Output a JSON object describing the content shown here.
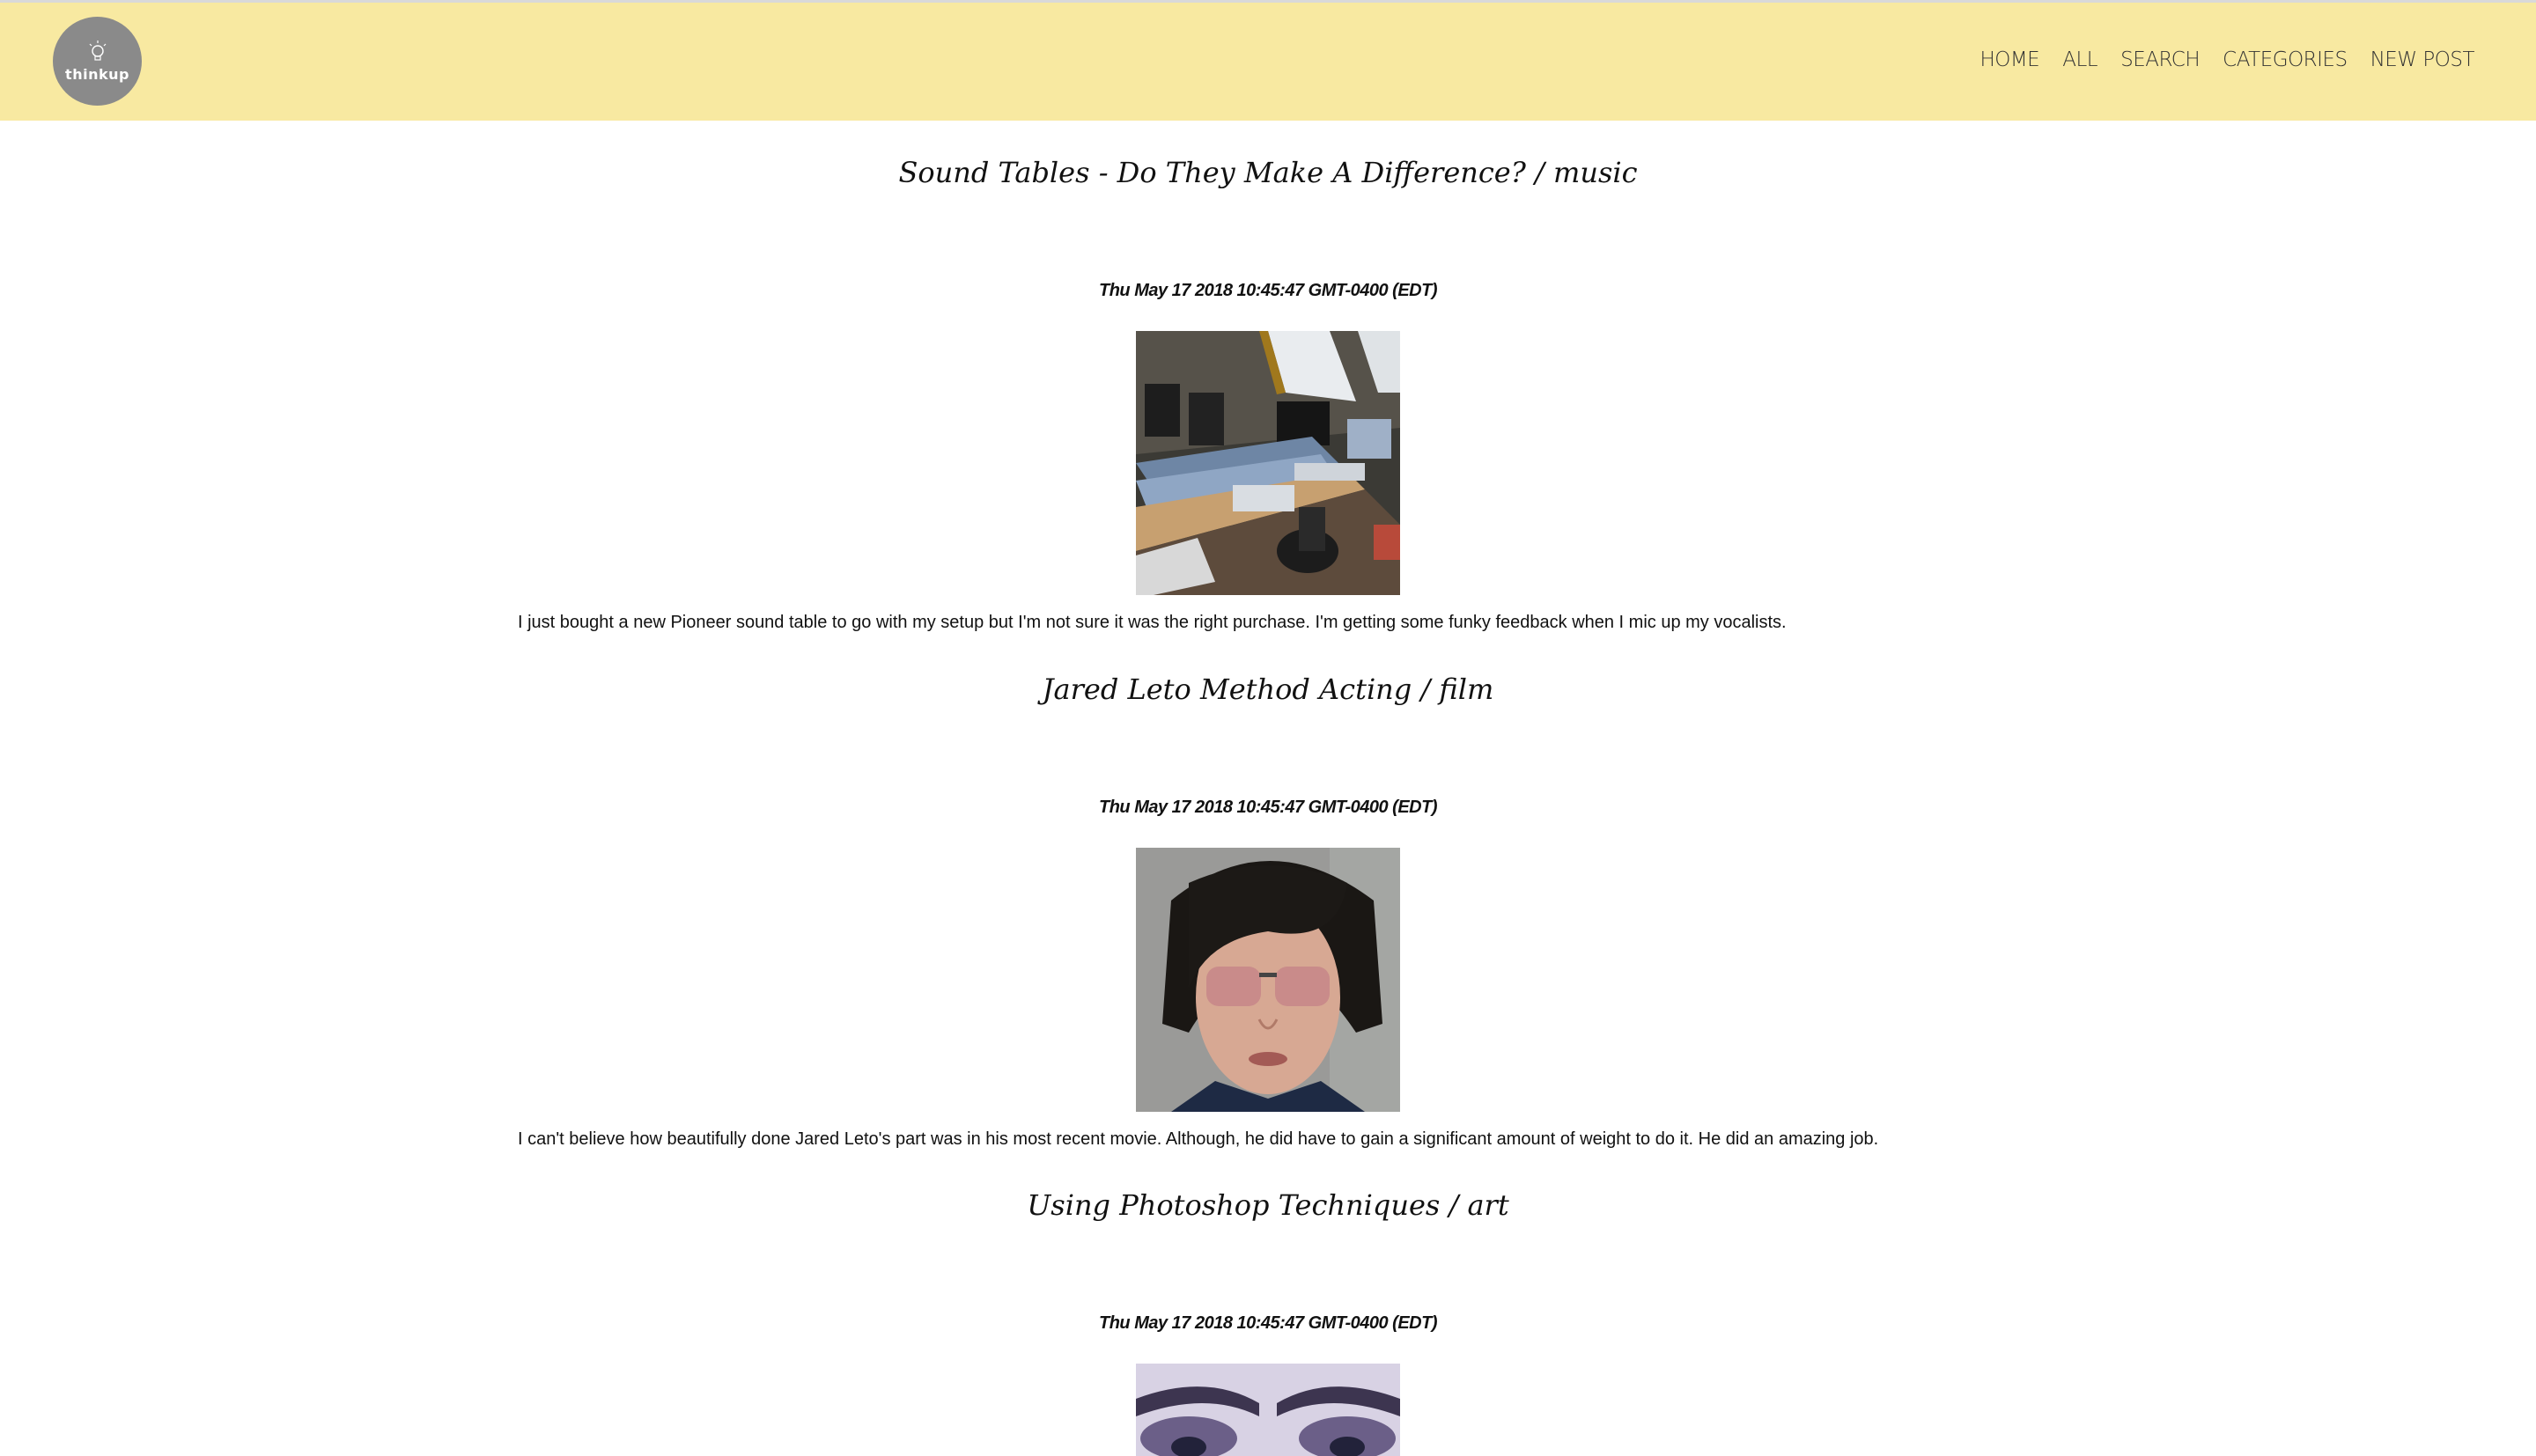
{
  "header": {
    "logo_text": "thinkup",
    "nav": [
      {
        "label": "HOME"
      },
      {
        "label": "ALL"
      },
      {
        "label": "SEARCH"
      },
      {
        "label": "CATEGORIES"
      },
      {
        "label": "NEW POST"
      }
    ],
    "background_color": "#f8e9a1",
    "logo_color": "#8a8a8a"
  },
  "posts": [
    {
      "title": "Sound Tables - Do They Make A Difference? / music",
      "date": "Thu May 17 2018 10:45:47 GMT-0400 (EDT)",
      "image": "recording-studio-photo",
      "body": "I just bought a new Pioneer sound table to go with my setup but I'm not sure it was the right purchase. I'm getting some funky feedback when I mic up my vocalists."
    },
    {
      "title": "Jared Leto Method Acting / film",
      "date": "Thu May 17 2018 10:45:47 GMT-0400 (EDT)",
      "image": "portrait-with-sunglasses-photo",
      "body": "I can't believe how beautifully done Jared Leto's part was in his most recent movie. Although, he did have to gain a significant amount of weight to do it. He did an amazing job."
    },
    {
      "title": "Using Photoshop Techniques / art",
      "date": "Thu May 17 2018 10:45:47 GMT-0400 (EDT)",
      "image": "eyes-makeup-photo",
      "body": ""
    }
  ]
}
